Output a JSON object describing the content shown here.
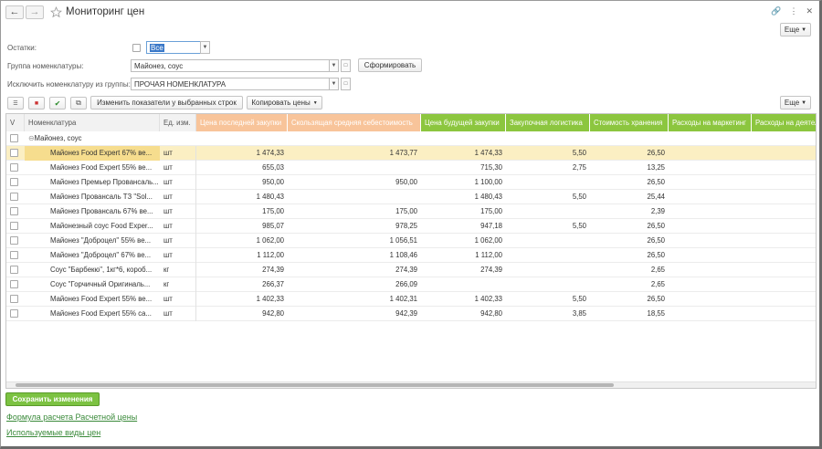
{
  "window": {
    "title": "Мониторинг цен"
  },
  "toolbar_more_top": "Еще",
  "filters": {
    "ostatki_label": "Остатки:",
    "ostatki_value": "Все",
    "group_label": "Группа номенклатуры:",
    "group_value": "Майонез, соус",
    "form_button": "Сформировать",
    "exclude_label": "Исключить номенклатуру из группы:",
    "exclude_value": "ПРОЧАЯ НОМЕНКЛАТУРА"
  },
  "toolbar": {
    "change_btn": "Изменить показатели у выбранных строк",
    "copy_btn": "Копировать цены",
    "more": "Еще"
  },
  "table": {
    "headers": [
      "V",
      "Номенклатура",
      "Ед. изм.",
      "Цена последней закупки",
      "Скользящая средняя себестоимость",
      "Цена будущей закупки",
      "Закупочная логистика",
      "Стоимость хранения",
      "Расходы на маркетинг",
      "Расходы на деятельность"
    ],
    "header_colors": [
      "#f2f2f2",
      "#f2f2f2",
      "#f2f2f2",
      "#f8c49a",
      "#f8c49a",
      "#8cc63f",
      "#8cc63f",
      "#8cc63f",
      "#8cc63f",
      "#8cc63f"
    ],
    "group_row": "Майонез, соус",
    "rows": [
      {
        "name": "Майонез Food Expert 67% ве...",
        "unit": "шт",
        "c1": "1 474,33",
        "c2": "1 473,77",
        "c3": "1 474,33",
        "c4": "5,50",
        "c5": "26,50"
      },
      {
        "name": "Майонез Food Expert 55% ве...",
        "unit": "шт",
        "c1": "655,03",
        "c2": "",
        "c3": "715,30",
        "c4": "2,75",
        "c5": "13,25"
      },
      {
        "name": "Майонез Премьер  Провансаль...",
        "unit": "шт",
        "c1": "950,00",
        "c2": "950,00",
        "c3": "1 100,00",
        "c4": "",
        "c5": "26,50"
      },
      {
        "name": "Майонез Провансаль ТЗ \"Sol...",
        "unit": "шт",
        "c1": "1 480,43",
        "c2": "",
        "c3": "1 480,43",
        "c4": "5,50",
        "c5": "25,44"
      },
      {
        "name": "Майонез Провансаль 67% ве...",
        "unit": "шт",
        "c1": "175,00",
        "c2": "175,00",
        "c3": "175,00",
        "c4": "",
        "c5": "2,39"
      },
      {
        "name": "Майонезный соус Food Exper...",
        "unit": "шт",
        "c1": "985,07",
        "c2": "978,25",
        "c3": "947,18",
        "c4": "5,50",
        "c5": "26,50"
      },
      {
        "name": "Майонез \"Доброцел\" 55% ве...",
        "unit": "шт",
        "c1": "1 062,00",
        "c2": "1 056,51",
        "c3": "1 062,00",
        "c4": "",
        "c5": "26,50"
      },
      {
        "name": "Майонез \"Доброцел\" 67% ве...",
        "unit": "шт",
        "c1": "1 112,00",
        "c2": "1 108,46",
        "c3": "1 112,00",
        "c4": "",
        "c5": "26,50"
      },
      {
        "name": "Соус \"Барбекю\", 1кг*6, короб...",
        "unit": "кг",
        "c1": "274,39",
        "c2": "274,39",
        "c3": "274,39",
        "c4": "",
        "c5": "2,65"
      },
      {
        "name": "Соус \"Горчичный Оригиналь...",
        "unit": "кг",
        "c1": "266,37",
        "c2": "266,09",
        "c3": "",
        "c4": "",
        "c5": "2,65"
      },
      {
        "name": "Майонез Food Expert 55% ве...",
        "unit": "шт",
        "c1": "1 402,33",
        "c2": "1 402,31",
        "c3": "1 402,33",
        "c4": "5,50",
        "c5": "26,50"
      },
      {
        "name": "Майонез Food Expert 55% са...",
        "unit": "шт",
        "c1": "942,80",
        "c2": "942,39",
        "c3": "942,80",
        "c4": "3,85",
        "c5": "18,55"
      }
    ]
  },
  "footer": {
    "save_btn": "Сохранить изменения",
    "link1": "Формула расчета Расчетной цены",
    "link2": "Используемые виды цен"
  }
}
